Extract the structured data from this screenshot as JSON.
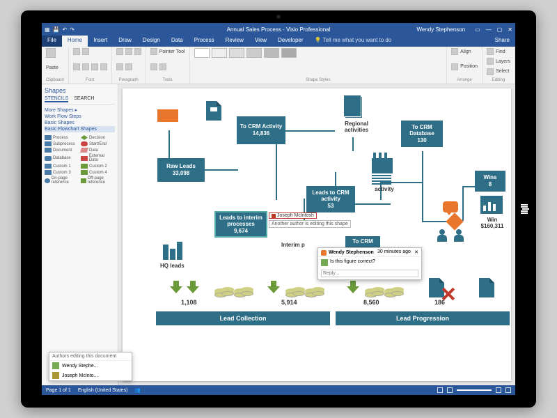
{
  "titlebar": {
    "doc_title": "Annual Sales Process - Visio Professional",
    "user": "Wendy Stephenson"
  },
  "ribbon_tabs": {
    "file": "File",
    "home": "Home",
    "insert": "Insert",
    "draw": "Draw",
    "design": "Design",
    "data": "Data",
    "process": "Process",
    "review": "Review",
    "view": "View",
    "developer": "Developer",
    "tell_me": "Tell me what you want to do",
    "share": "Share"
  },
  "ribbon_groups": {
    "clipboard": "Clipboard",
    "font": "Font",
    "paragraph": "Paragraph",
    "tools": "Tools",
    "shape_styles": "Shape Styles",
    "arrange": "Arrange",
    "editing": "Editing",
    "paste": "Paste",
    "pointer": "Pointer Tool",
    "align": "Align",
    "position": "Position",
    "find": "Find",
    "layers": "Layers",
    "select": "Select"
  },
  "shapes": {
    "title": "Shapes",
    "tab_stencils": "STENCILS",
    "tab_search": "SEARCH",
    "cat_more": "More Shapes",
    "cat_workflow": "Work Flow Steps",
    "cat_basic": "Basic Shapes",
    "cat_flowchart": "Basic Flowchart Shapes",
    "items": {
      "process": "Process",
      "decision": "Decision",
      "subprocess": "Subprocess",
      "startend": "Start/End",
      "document": "Document",
      "data": "Data",
      "database": "Database",
      "external": "External Data",
      "custom1": "Custom 1",
      "custom2": "Custom 2",
      "custom3": "Custom 3",
      "custom4": "Custom 4",
      "onpage": "On-page reference",
      "offpage": "Off-page reference"
    }
  },
  "diagram": {
    "raw_leads": {
      "label": "Raw Leads",
      "value": "33,098"
    },
    "to_crm_activity": {
      "label": "To CRM Activity",
      "value": "14,836"
    },
    "regional": "Regional activities",
    "to_crm_db": {
      "label": "To CRM Database",
      "value": "130"
    },
    "leads_crm": {
      "label": "Leads to CRM activity",
      "value": "53"
    },
    "activity": "activity",
    "leads_interim": {
      "label": "Leads to interim processes",
      "value": "9,674"
    },
    "interim": "Interim p",
    "to_crm": "To CRM",
    "wins": {
      "label": "Wins",
      "value": "8"
    },
    "win_total": {
      "label": "Win",
      "value": "$160,311"
    },
    "hq_leads": "HQ leads",
    "v1": "1,108",
    "v2": "5,914",
    "v3": "8,560",
    "v4": "186",
    "banner_collection": "Lead Collection",
    "banner_progression": "Lead Progression"
  },
  "presence": {
    "name": "Joseph McIntosh",
    "msg": "Another author is editing this shape"
  },
  "comment": {
    "author": "Wendy Stephenson",
    "time": "30 minutes ago",
    "text": "Is this figure correct?",
    "reply_placeholder": "Reply..."
  },
  "authors": {
    "title": "Authors editing this document",
    "p1": "Wendy Stephe...",
    "p2": "Joseph McInto..."
  },
  "statusbar": {
    "page": "Page 1 of 1",
    "lang": "English (United States)"
  }
}
